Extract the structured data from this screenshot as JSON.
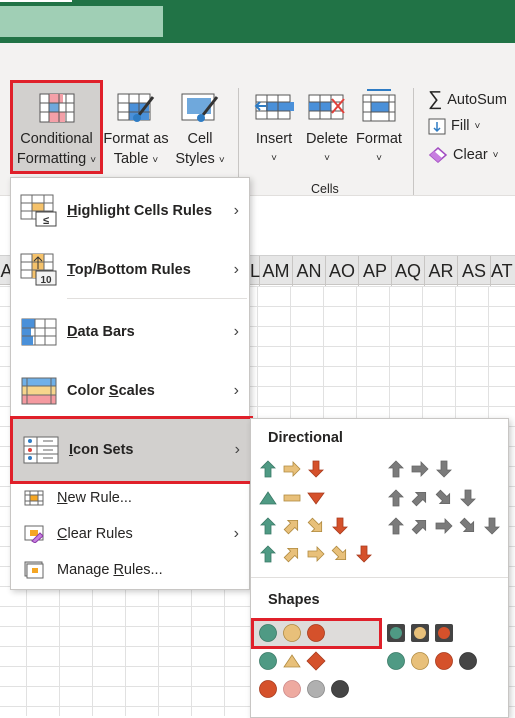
{
  "ribbon": {
    "conditional_formatting": {
      "line1": "Conditional",
      "line2": "Formatting"
    },
    "format_as_table": {
      "line1": "Format as",
      "line2": "Table"
    },
    "cell_styles": {
      "line1": "Cell",
      "line2": "Styles"
    },
    "insert": "Insert",
    "delete": "Delete",
    "format": "Format",
    "cells_group": "Cells",
    "autosum": "AutoSum",
    "fill": "Fill",
    "clear": "Clear"
  },
  "columns": [
    "L",
    "AM",
    "AN",
    "AO",
    "AP",
    "AQ",
    "AR",
    "AS",
    "AT",
    "A"
  ],
  "menu": {
    "highlight": {
      "u": "H",
      "rest": "ighlight Cells Rules"
    },
    "topbottom": {
      "u": "T",
      "rest": "op/Bottom Rules"
    },
    "databars": {
      "u": "D",
      "rest": "ata Bars"
    },
    "colorscales": {
      "pre": "Color ",
      "u": "S",
      "rest": "cales"
    },
    "iconsets": {
      "u": "I",
      "rest": "con Sets"
    },
    "newrule": {
      "u": "N",
      "rest": "ew Rule..."
    },
    "clearrules": {
      "u": "C",
      "rest": "lear Rules"
    },
    "managerules": {
      "pre": "Manage ",
      "u": "R",
      "rest": "ules..."
    }
  },
  "submenu": {
    "directional_title": "Directional",
    "shapes_title": "Shapes",
    "colors": {
      "green": "#4f9a84",
      "yellow": "#e8c07a",
      "red": "#d5512b",
      "gray": "#7b7b7b",
      "pink": "#eeaaa0",
      "lightgray": "#b0b0b0",
      "dark": "#454545",
      "accent_red": "#e0202a",
      "excel_green": "#217346"
    },
    "directional": [
      {
        "icons": [
          [
            "arrow",
            "green",
            "up"
          ],
          [
            "arrow",
            "yellow",
            "right"
          ],
          [
            "arrow",
            "red",
            "down"
          ]
        ]
      },
      {
        "icons": [
          [
            "arrow",
            "gray",
            "up"
          ],
          [
            "arrow",
            "gray",
            "right"
          ],
          [
            "arrow",
            "gray",
            "down"
          ]
        ]
      },
      {
        "icons": [
          [
            "triangle",
            "green",
            "up"
          ],
          [
            "dash",
            "yellow",
            "right"
          ],
          [
            "triangle",
            "red",
            "down"
          ]
        ]
      },
      {
        "icons": [
          [
            "arrow",
            "gray",
            "up"
          ],
          [
            "arrow",
            "gray",
            "upright"
          ],
          [
            "arrow",
            "gray",
            "downright"
          ],
          [
            "arrow",
            "gray",
            "down"
          ]
        ]
      },
      {
        "icons": [
          [
            "arrow",
            "green",
            "up"
          ],
          [
            "arrow",
            "yellow",
            "upright"
          ],
          [
            "arrow",
            "yellow",
            "downright"
          ],
          [
            "arrow",
            "red",
            "down"
          ]
        ]
      },
      {
        "icons": [
          [
            "arrow",
            "gray",
            "up"
          ],
          [
            "arrow",
            "gray",
            "upright"
          ],
          [
            "arrow",
            "gray",
            "right"
          ],
          [
            "arrow",
            "gray",
            "downright"
          ],
          [
            "arrow",
            "gray",
            "down"
          ]
        ]
      },
      {
        "icons": [
          [
            "arrow",
            "green",
            "up"
          ],
          [
            "arrow",
            "yellow",
            "upright"
          ],
          [
            "arrow",
            "yellow",
            "right"
          ],
          [
            "arrow",
            "yellow",
            "downright"
          ],
          [
            "arrow",
            "red",
            "down"
          ]
        ]
      }
    ],
    "shapes": [
      {
        "icons": [
          [
            "circle",
            "green"
          ],
          [
            "circle",
            "yellow"
          ],
          [
            "circle",
            "red"
          ]
        ],
        "selected": true
      },
      {
        "icons": [
          [
            "boxed",
            "green"
          ],
          [
            "boxed",
            "yellow"
          ],
          [
            "boxed",
            "red"
          ]
        ]
      },
      {
        "icons": [
          [
            "circle",
            "green"
          ],
          [
            "triangle",
            "yellow",
            "up"
          ],
          [
            "diamond",
            "red"
          ]
        ]
      },
      {
        "icons": [
          [
            "circle",
            "green"
          ],
          [
            "circle",
            "yellow"
          ],
          [
            "circle",
            "red"
          ],
          [
            "circle",
            "dark"
          ]
        ]
      },
      {
        "icons": [
          [
            "circle",
            "red"
          ],
          [
            "circle",
            "pink"
          ],
          [
            "circle",
            "lightgray"
          ],
          [
            "circle",
            "dark"
          ]
        ]
      }
    ]
  }
}
